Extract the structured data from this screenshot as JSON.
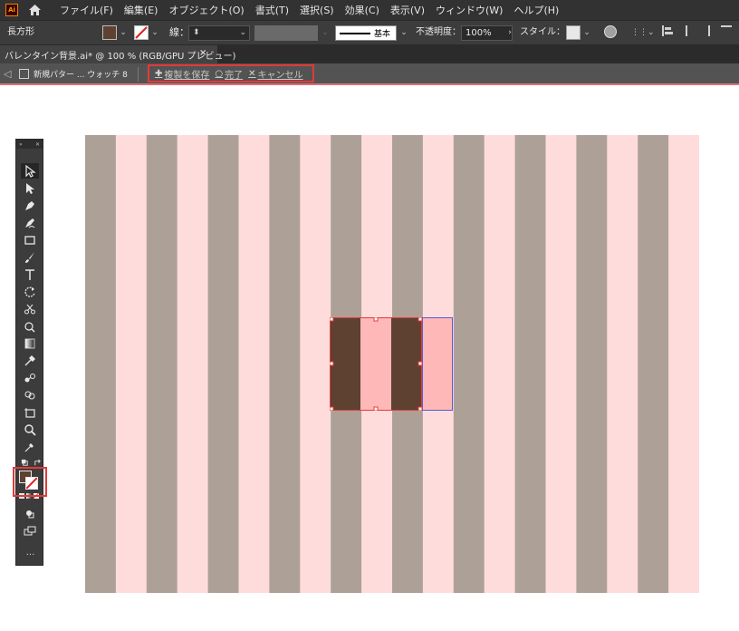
{
  "app": {
    "logo_text": "Ai",
    "menu": [
      "ファイル(F)",
      "編集(E)",
      "オブジェクト(O)",
      "書式(T)",
      "選択(S)",
      "効果(C)",
      "表示(V)",
      "ウィンドウ(W)",
      "ヘルプ(H)"
    ]
  },
  "controlbar": {
    "object_type": "長方形",
    "fill_color": "#5e4131",
    "stroke_label": "線：",
    "stroke_weight": "",
    "stroke_profile": "基本",
    "opacity_label": "不透明度：",
    "opacity_value": "100%",
    "style_label": "スタイル："
  },
  "document_tab": {
    "title": "バレンタイン背景.ai* @ 100 % (RGB/GPU プレビュー)",
    "close": "×"
  },
  "pattern_bar": {
    "back": "◁",
    "name": "新規パター ... ウォッチ 8",
    "save_copy": "複製を保存",
    "done": "完了",
    "cancel": "キャンセル"
  },
  "canvas": {
    "stripe_colors": {
      "dark": "#ada197",
      "light": "#ffdcdc",
      "selected_dark": "#5e4131",
      "selected_light": "#ffb8b8"
    },
    "selection_color": "#e23b3b",
    "tile_bound_color": "#5a5ad8"
  },
  "tools": {
    "list": [
      "selection-tool",
      "direct-selection-tool",
      "pen-tool",
      "curvature-tool",
      "rectangle-tool",
      "paintbrush-tool",
      "type-tool",
      "rotate-tool",
      "scissors-tool",
      "warp-tool",
      "gradient-tool",
      "eyedropper-tool",
      "blend-tool",
      "shape-builder-tool",
      "artboard-tool",
      "zoom-tool",
      "eyedropper-alt-tool"
    ],
    "more": "..."
  }
}
